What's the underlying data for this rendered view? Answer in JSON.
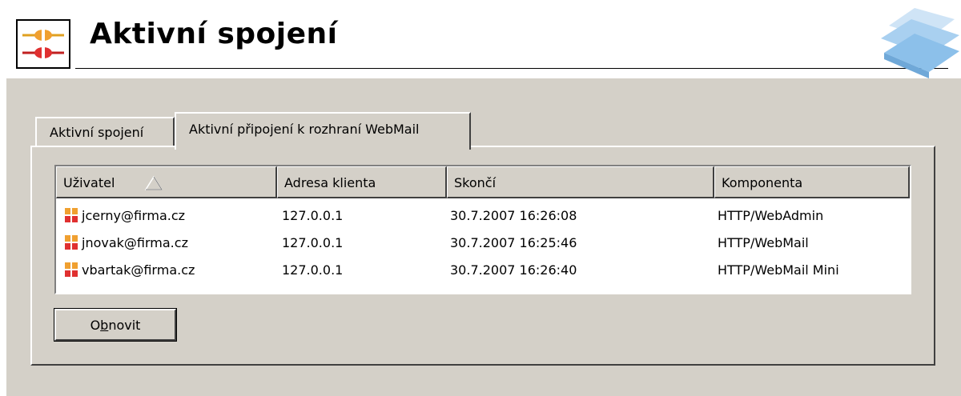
{
  "header": {
    "title": "Aktivní spojení",
    "icon": "connections-icon",
    "logo": "brand-logo"
  },
  "tabs": [
    {
      "label": "Aktivní spojení",
      "active": false
    },
    {
      "label": "Aktivní připojení k rozhraní WebMail",
      "active": true
    }
  ],
  "table": {
    "columns": [
      "Uživatel",
      "Adresa klienta",
      "Skončí",
      "Komponenta"
    ],
    "sort_column": "Uživatel",
    "sort_direction": "ascending",
    "rows": [
      {
        "user": "jcerny@firma.cz",
        "address": "127.0.0.1",
        "expires": "30.7.2007 16:26:08",
        "component": "HTTP/WebAdmin"
      },
      {
        "user": "jnovak@firma.cz",
        "address": "127.0.0.1",
        "expires": "30.7.2007 16:25:46",
        "component": "HTTP/WebMail"
      },
      {
        "user": "vbartak@firma.cz",
        "address": "127.0.0.1",
        "expires": "30.7.2007 16:26:40",
        "component": "HTTP/WebMail Mini"
      }
    ]
  },
  "refresh_button": {
    "label_pre": "O",
    "label_accel": "b",
    "label_post": "novit"
  },
  "colors": {
    "panel": "#d4d0c8",
    "icon_orange": "#f0a030",
    "icon_red": "#e03030",
    "logo_blue": "#9cc8ec"
  }
}
